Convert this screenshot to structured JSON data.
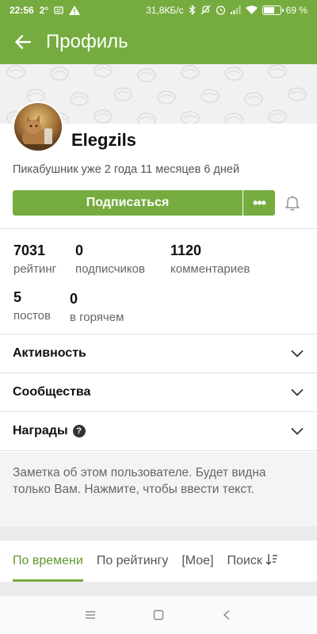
{
  "status_bar": {
    "time": "22:56",
    "temperature": "2°",
    "speed": "31,8КБ/с",
    "battery_text": "69 %",
    "battery_level": 0.69
  },
  "app_bar": {
    "title": "Профиль"
  },
  "profile": {
    "username": "Elegzils",
    "since": "Пикабушник уже 2 года 11 месяцев 6 дней",
    "subscribe_label": "Подписаться",
    "more_label": "•••"
  },
  "stats": [
    {
      "value": "7031",
      "label": "рейтинг"
    },
    {
      "value": "0",
      "label": "подписчиков"
    },
    {
      "value": "1120",
      "label": "комментариев"
    },
    {
      "value": "5",
      "label": "постов"
    },
    {
      "value": "0",
      "label": "в горячем"
    }
  ],
  "sections": [
    {
      "label": "Активность"
    },
    {
      "label": "Сообщества"
    },
    {
      "label": "Награды",
      "help": "?"
    }
  ],
  "note": {
    "text": "Заметка об этом пользователе. Будет видна только Вам. Нажмите, чтобы ввести текст."
  },
  "tabs": [
    {
      "label": "По времени",
      "active": true
    },
    {
      "label": "По рейтингу"
    },
    {
      "label": "[Мое]"
    },
    {
      "label": "Поиск"
    }
  ],
  "colors": {
    "brand_green": "#76ac3f",
    "active_tab_text": "#5f9a2e"
  },
  "icons": [
    "back-arrow-icon",
    "bell-icon",
    "chevron-down-icon",
    "help-icon",
    "sort-icon",
    "menu-icon",
    "home-square-icon",
    "back-triangle-icon"
  ]
}
